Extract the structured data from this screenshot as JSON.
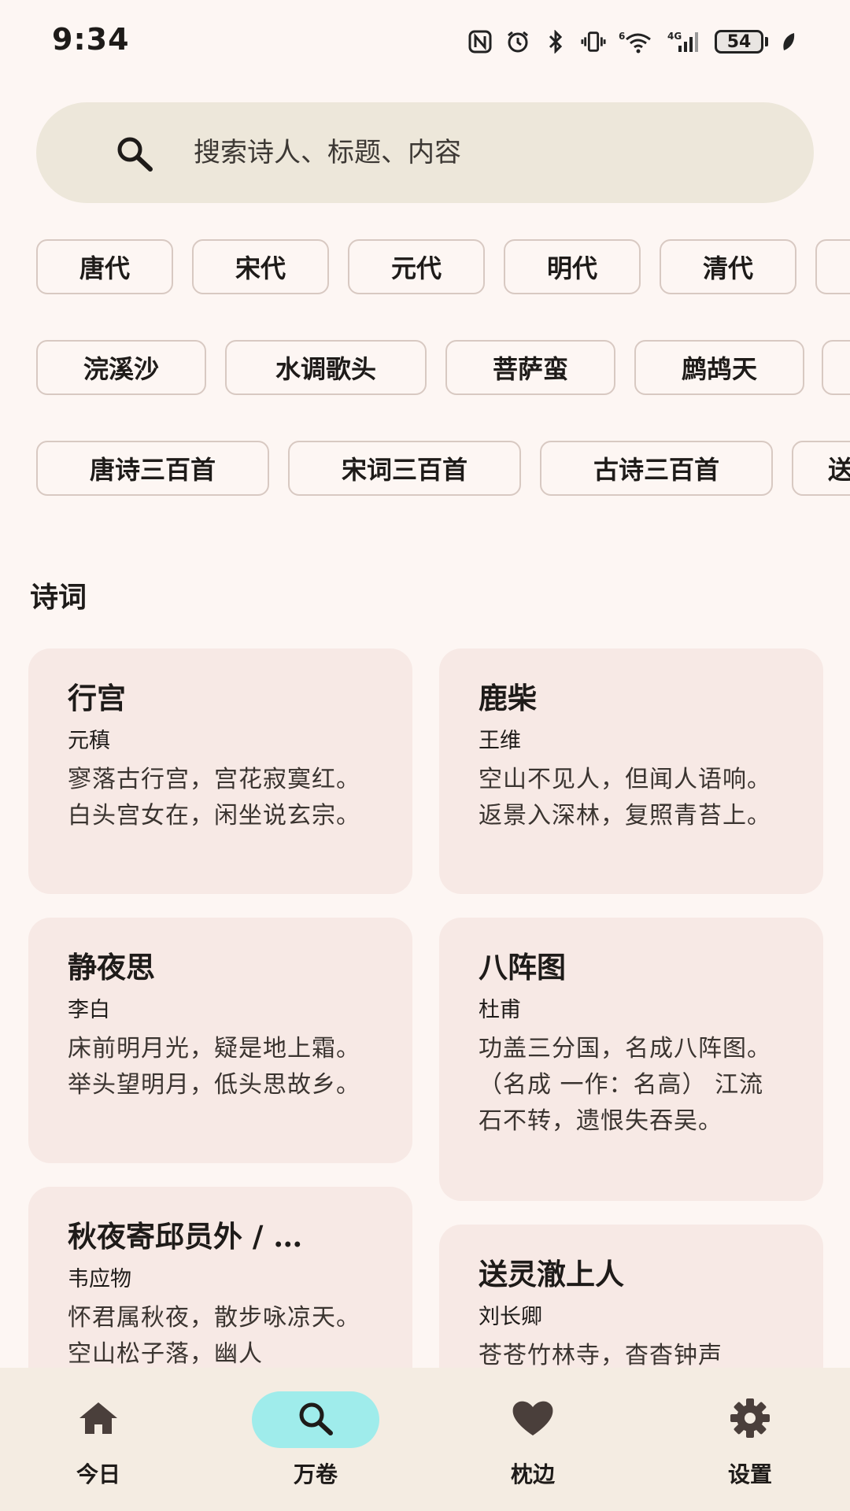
{
  "status_bar": {
    "time": "9:34",
    "icons": [
      "nfc-icon",
      "alarm-icon",
      "bluetooth-icon",
      "vibrate-icon",
      "wifi-icon",
      "signal-icon",
      "battery-icon",
      "leaf-icon"
    ],
    "wifi_label": "6",
    "signal_label": "4G",
    "battery_level": "54"
  },
  "search": {
    "placeholder": "搜索诗人、标题、内容"
  },
  "chips": {
    "dynasties": [
      "唐代",
      "宋代",
      "元代",
      "明代",
      "清代"
    ],
    "tunes": [
      "浣溪沙",
      "水调歌头",
      "菩萨蛮",
      "鹧鸪天"
    ],
    "collections": [
      "唐诗三百首",
      "宋词三百首",
      "古诗三百首",
      "送"
    ]
  },
  "section": {
    "title": "诗词"
  },
  "poems": [
    {
      "title": "行宫",
      "author": "元稹",
      "excerpt": "寥落古行宫，宫花寂寞红。 白头宫女在，闲坐说玄宗。"
    },
    {
      "title": "鹿柴",
      "author": "王维",
      "excerpt": "空山不见人，但闻人语响。 返景入深林，复照青苔上。"
    },
    {
      "title": "静夜思",
      "author": "李白",
      "excerpt": "床前明月光，疑是地上霜。 举头望明月，低头思故乡。"
    },
    {
      "title": "八阵图",
      "author": "杜甫",
      "excerpt": "功盖三分国，名成八阵图。（名成 一作：名高） 江流石不转，遗恨失吞吴。"
    },
    {
      "title": "秋夜寄邱员外 / …",
      "author": "韦应物",
      "excerpt": "怀君属秋夜，散步咏凉天。 空山松子落，幽人"
    },
    {
      "title": "送灵澈上人",
      "author": "刘长卿",
      "excerpt": "苍苍竹林寺，杳杳钟声"
    }
  ],
  "nav": {
    "items": [
      {
        "label": "今日",
        "icon": "home-icon",
        "active": false
      },
      {
        "label": "万卷",
        "icon": "search-icon",
        "active": true
      },
      {
        "label": "枕边",
        "icon": "heart-icon",
        "active": false
      },
      {
        "label": "设置",
        "icon": "gear-icon",
        "active": false
      }
    ]
  },
  "colors": {
    "background": "#FDF6F3",
    "card": "#F7E9E5",
    "search_bar": "#EDE7DA",
    "nav_bar": "#F4ECE2",
    "active_pill": "#9FECEB",
    "chip_border": "#D8C9C2"
  }
}
